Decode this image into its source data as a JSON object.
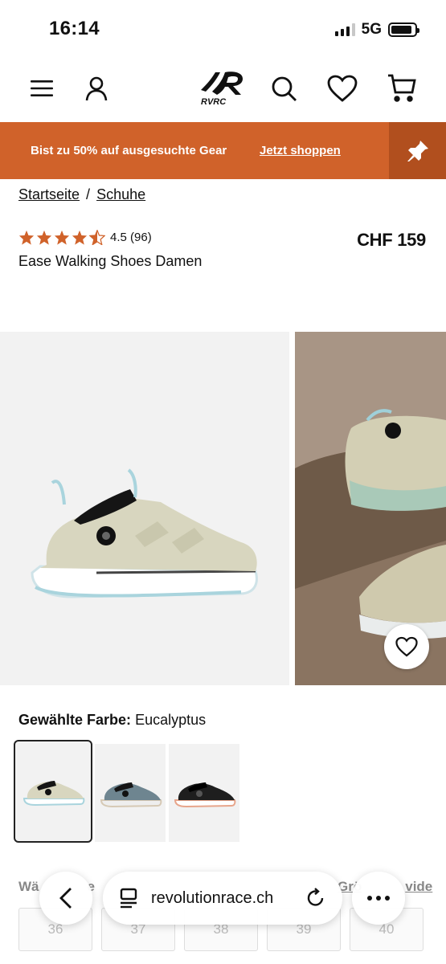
{
  "status_bar": {
    "time": "16:14",
    "network": "5G"
  },
  "header": {
    "logo_text": "RVRC"
  },
  "promo": {
    "text": "Bist zu 50% auf ausgesuchte Gear",
    "link": "Jetzt shoppen"
  },
  "breadcrumb": [
    {
      "label": "Startseite"
    },
    {
      "separator": "/"
    },
    {
      "label": "Schuhe"
    }
  ],
  "product": {
    "rating": 4.5,
    "rating_text": "4.5 (96)",
    "title": "Ease Walking Shoes Damen",
    "price": "CHF 159"
  },
  "color": {
    "label": "Gewählte Farbe:",
    "value": "Eucalyptus"
  },
  "colors": {
    "accent": "#d0622a",
    "star": "#d0622a"
  },
  "size": {
    "label_fragment_left": "Wä",
    "label_fragment_mid": "e",
    "guide_fragment": "Grö",
    "guide_fragment_end": "vide",
    "options": [
      "36",
      "37",
      "38",
      "39",
      "40"
    ]
  },
  "browser": {
    "url": "revolutionrace.ch"
  }
}
